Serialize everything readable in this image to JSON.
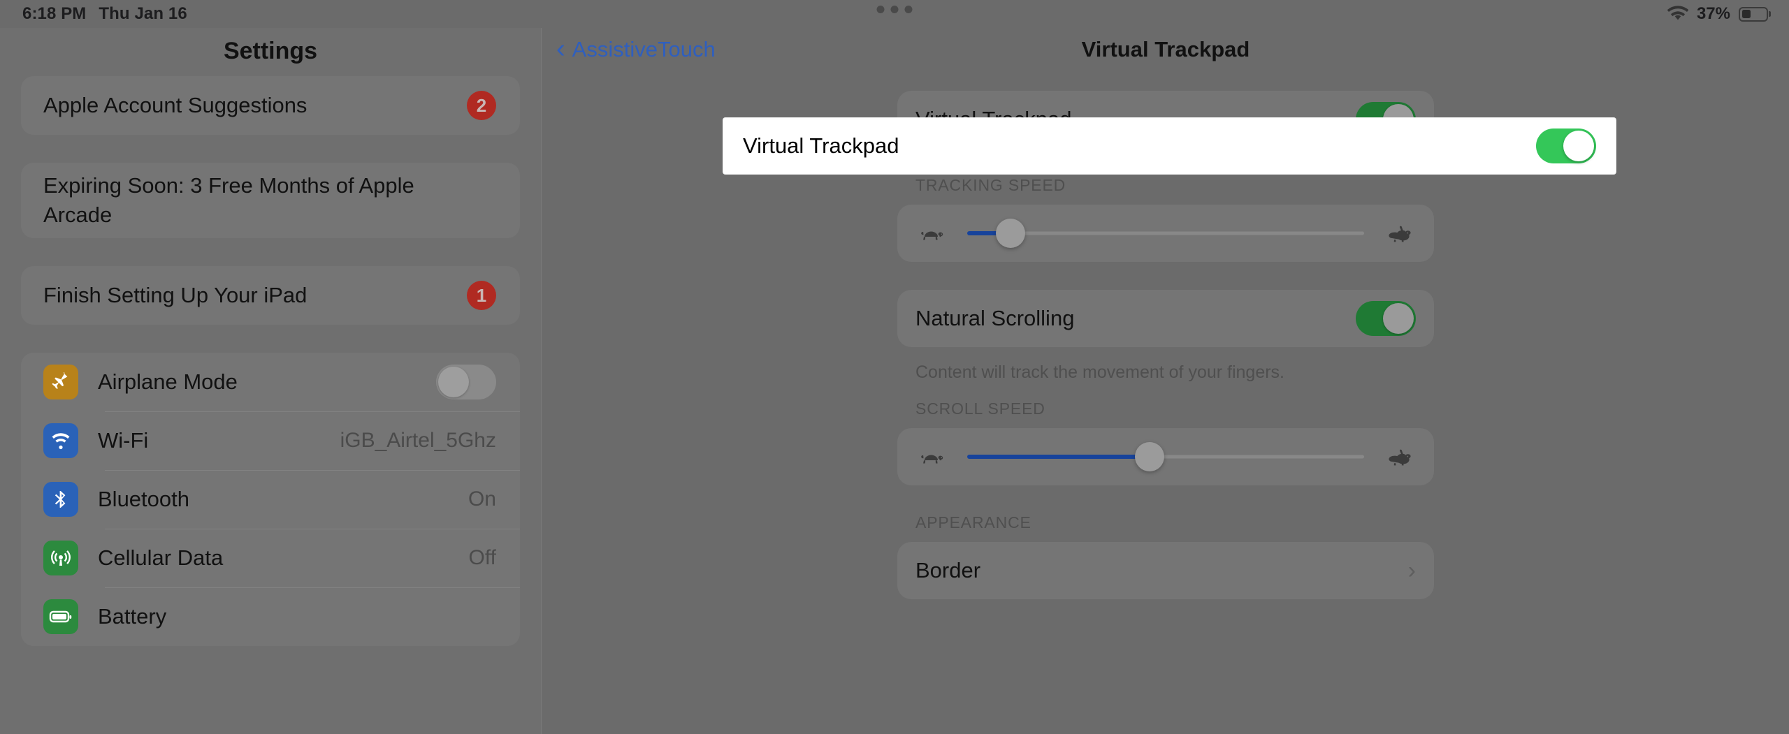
{
  "status_bar": {
    "time": "6:18 PM",
    "date": "Thu Jan 16",
    "wifi_icon": "wifi-icon",
    "battery_percent": "37%",
    "battery_level": 37,
    "multitask_dots_icon": "multitasking-dots-icon"
  },
  "sidebar": {
    "title": "Settings",
    "groups": [
      {
        "rows": [
          {
            "label": "Apple Account Suggestions",
            "badge": "2",
            "type": "badge"
          }
        ]
      },
      {
        "rows": [
          {
            "label": "Expiring Soon: 3 Free Months of Apple Arcade",
            "type": "plain"
          }
        ]
      },
      {
        "rows": [
          {
            "label": "Finish Setting Up Your iPad",
            "badge": "1",
            "type": "badge"
          }
        ]
      },
      {
        "rows": [
          {
            "label": "Airplane Mode",
            "icon": "airplane-icon",
            "icon_color": "#b8821a",
            "type": "toggle",
            "toggle_on": false
          },
          {
            "label": "Wi-Fi",
            "icon": "wifi-icon",
            "icon_color": "#2a62b8",
            "type": "value",
            "value": "iGB_Airtel_5Ghz"
          },
          {
            "label": "Bluetooth",
            "icon": "bluetooth-icon",
            "icon_color": "#2a62b8",
            "type": "value",
            "value": "On"
          },
          {
            "label": "Cellular Data",
            "icon": "cellular-icon",
            "icon_color": "#2c8a3e",
            "type": "value",
            "value": "Off"
          },
          {
            "label": "Battery",
            "icon": "battery-icon",
            "icon_color": "#2c8a3e",
            "type": "plain"
          }
        ]
      }
    ]
  },
  "detail": {
    "back_label": "AssistiveTouch",
    "back_icon": "chevron-left-icon",
    "title": "Virtual Trackpad",
    "focus_row": {
      "label": "Virtual Trackpad",
      "toggle_on": true,
      "toggle_color": "#34c759"
    },
    "tracking_speed": {
      "header": "TRACKING SPEED",
      "slow_icon": "tortoise-icon",
      "fast_icon": "hare-icon",
      "value_percent": 11,
      "fill_color": "#17439b"
    },
    "natural_scrolling": {
      "label": "Natural Scrolling",
      "toggle_on": true,
      "footer": "Content will track the movement of your fingers."
    },
    "scroll_speed": {
      "header": "SCROLL SPEED",
      "slow_icon": "tortoise-icon",
      "fast_icon": "hare-icon",
      "value_percent": 46,
      "fill_color": "#17439b"
    },
    "appearance": {
      "header": "APPEARANCE",
      "rows": [
        {
          "label": "Border",
          "accessory": "chevron-right-icon",
          "chevron": "›"
        }
      ]
    }
  }
}
